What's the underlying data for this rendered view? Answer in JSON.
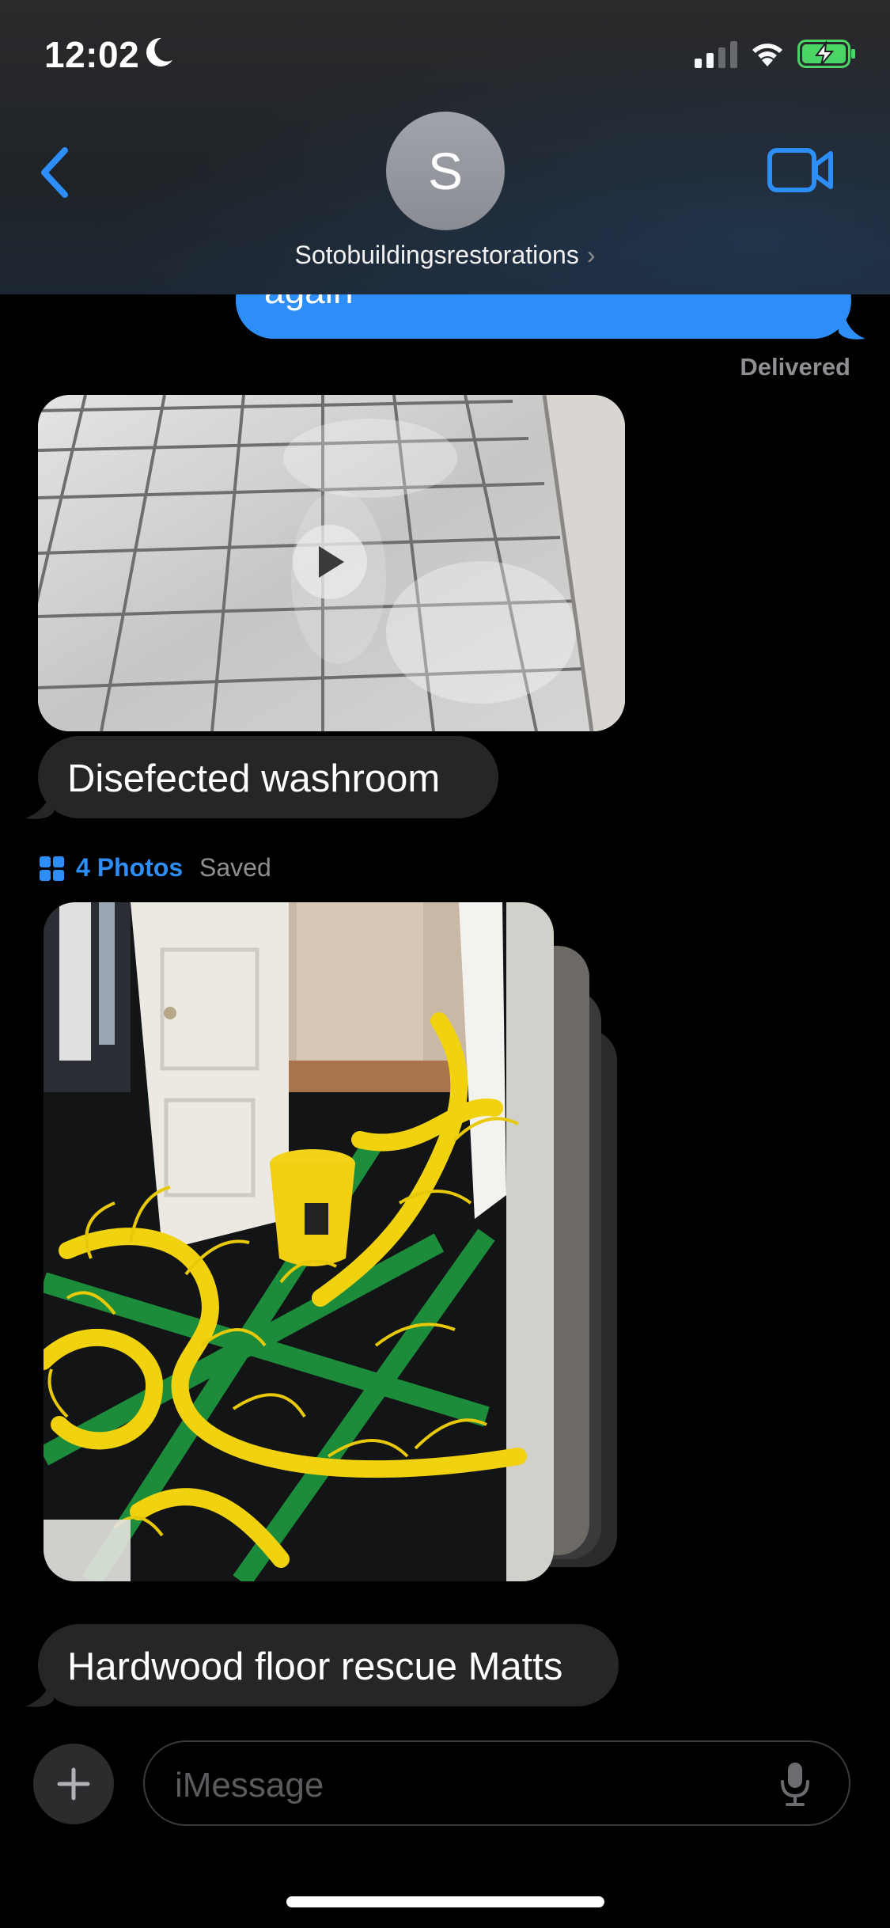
{
  "status_bar": {
    "time": "12:02",
    "icons": [
      "moon-icon",
      "signal-icon",
      "wifi-icon",
      "battery-charging-icon"
    ]
  },
  "header": {
    "avatar_initial": "S",
    "contact_name": "Sotobuildingsrestorations",
    "chevron": "›",
    "icons": [
      "back-chevron-icon",
      "video-camera-icon"
    ]
  },
  "messages": {
    "sent_text": "again",
    "delivered": "Delivered",
    "video_caption": "Disefected washroom",
    "photos_count": "4 Photos",
    "photos_saved": "Saved",
    "photos_caption": "Hardwood floor rescue Matts"
  },
  "input": {
    "placeholder": "iMessage",
    "icons": [
      "plus-icon",
      "mic-icon"
    ]
  },
  "colors": {
    "accent_blue": "#2c8ef6",
    "received_bubble": "#262628",
    "background": "#000000"
  }
}
